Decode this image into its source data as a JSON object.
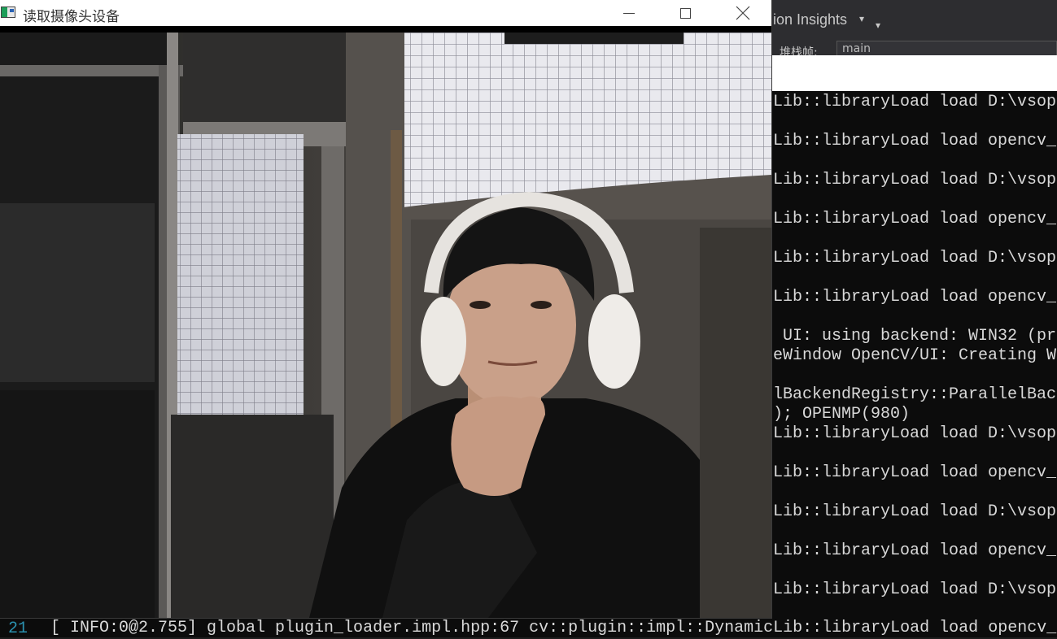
{
  "camera_window": {
    "title": "读取摄像头设备",
    "buttons": {
      "minimize_icon": "minimize-icon",
      "maximize_icon": "maximize-icon",
      "close_icon": "close-icon"
    }
  },
  "ide": {
    "toolbar_label": "ion Insights",
    "stack_frame_label": "堆栈帧:",
    "stack_frame_value": "main"
  },
  "console": {
    "lines": [
      "Lib::libraryLoad load D:\\vsop",
      "Lib::libraryLoad load opencv_",
      "Lib::libraryLoad load D:\\vsop",
      "Lib::libraryLoad load opencv_",
      "Lib::libraryLoad load D:\\vsop",
      "Lib::libraryLoad load opencv_",
      " UI: using backend: WIN32 (pr",
      "eWindow OpenCV/UI: Creating W",
      "lBackendRegistry::ParallelBac",
      "); OPENMP(980)",
      "Lib::libraryLoad load D:\\vsop",
      "Lib::libraryLoad load opencv_",
      "Lib::libraryLoad load D:\\vsop",
      "Lib::libraryLoad load opencv_",
      "Lib::libraryLoad load D:\\vsop"
    ],
    "bottom_line_number": "21",
    "bottom_line_text": "[ INFO:0@2.755] global plugin_loader.impl.hpp:67 cv::plugin::impl::DynamicLib::libraryLoad load opencv_"
  }
}
